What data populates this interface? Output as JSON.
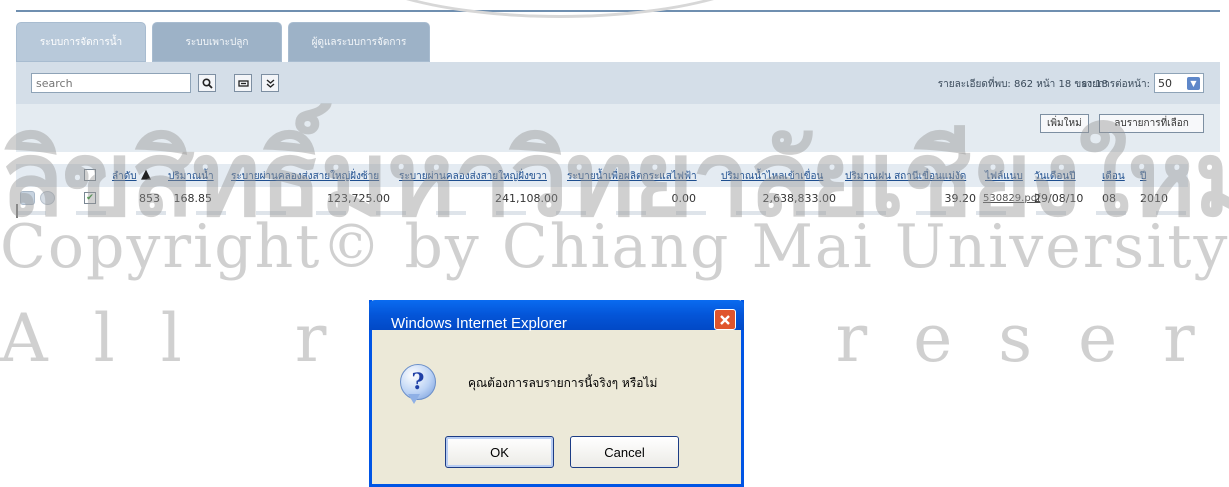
{
  "tabs": [
    {
      "label": "ระบบการจัดการน้ำ",
      "active": true
    },
    {
      "label": "ระบบเพาะปลูก",
      "active": false
    },
    {
      "label": "ผู้ดูแลระบบการจัดการ",
      "active": false
    }
  ],
  "toolbar": {
    "search_placeholder": "search",
    "search_icon": "magnifier-icon",
    "info_text": "รายละเอียดที่พบ: 862  หน้า 18 ของ 18",
    "per_page_label": "รายการต่อหน้า:",
    "per_page_value": "50"
  },
  "actions": {
    "add_label": "เพิ่มใหม่",
    "delete_selected_label": "ลบรายการที่เลือก"
  },
  "table": {
    "columns": [
      "ลำดับ",
      "ปริมาณน้ำ",
      "ระบายผ่านคลองส่งสายใหญ่ฝั่งซ้าย",
      "ระบายผ่านคลองส่งสายใหญ่ฝั่งขวา",
      "ระบายน้ำเพื่อผลิตกระแสไฟฟ้า",
      "ปริมาณน้ำไหลเข้าเขื่อน",
      "ปริมาณฝน สถานีเขื่อนแม่งัด",
      "ไฟล์แนบ",
      "วันเดือนปี",
      "เดือน",
      "ปี"
    ],
    "rows": [
      {
        "id": "853",
        "volume": "168.85",
        "left_canal": "123,725.00",
        "right_canal": "241,108.00",
        "power": "0.00",
        "inflow": "2,638,833.00",
        "rain": "39.20",
        "file": "530829.pdf",
        "date": "29/08/10",
        "month": "08",
        "year": "2010"
      }
    ]
  },
  "watermark": {
    "line1": "ลิขสิทธิ์มหาวิทยาลัยเชียงใหม่",
    "line2": "Copyright© by Chiang Mai University",
    "line3": "All rights reserved"
  },
  "dialog": {
    "title": "Windows Internet Explorer",
    "message": "คุณต้องการลบรายการนี้จริงๆ หรือไม่",
    "ok_label": "OK",
    "cancel_label": "Cancel"
  }
}
